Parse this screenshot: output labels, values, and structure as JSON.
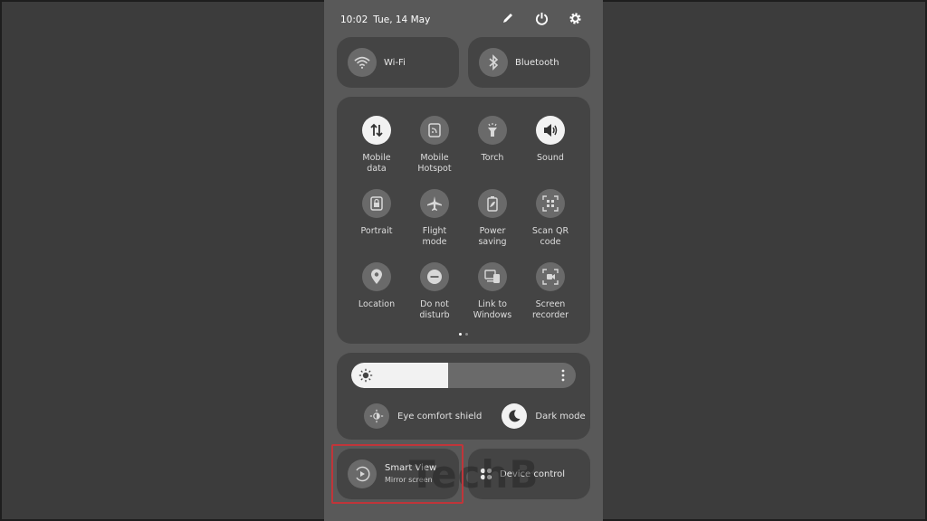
{
  "status": {
    "time": "10:02",
    "date": "Tue, 14 May"
  },
  "header_icons": [
    "edit-icon",
    "power-icon",
    "settings-icon"
  ],
  "top_tiles": [
    {
      "label": "Wi-Fi",
      "icon": "wifi-icon"
    },
    {
      "label": "Bluetooth",
      "icon": "bluetooth-icon"
    }
  ],
  "quick_settings": [
    {
      "label": "Mobile\ndata",
      "icon": "mobile-data-icon",
      "active": true
    },
    {
      "label": "Mobile\nHotspot",
      "icon": "hotspot-icon",
      "active": false
    },
    {
      "label": "Torch",
      "icon": "torch-icon",
      "active": false
    },
    {
      "label": "Sound",
      "icon": "sound-icon",
      "active": true
    },
    {
      "label": "Portrait",
      "icon": "portrait-lock-icon",
      "active": false
    },
    {
      "label": "Flight\nmode",
      "icon": "airplane-icon",
      "active": false
    },
    {
      "label": "Power\nsaving",
      "icon": "battery-saving-icon",
      "active": false
    },
    {
      "label": "Scan QR\ncode",
      "icon": "qr-scan-icon",
      "active": false
    },
    {
      "label": "Location",
      "icon": "location-icon",
      "active": false
    },
    {
      "label": "Do not\ndisturb",
      "icon": "do-not-disturb-icon",
      "active": false
    },
    {
      "label": "Link to\nWindows",
      "icon": "link-to-windows-icon",
      "active": false
    },
    {
      "label": "Screen\nrecorder",
      "icon": "screen-recorder-icon",
      "active": false
    }
  ],
  "brightness": {
    "level_percent": 43
  },
  "display_toggles": [
    {
      "label": "Eye comfort shield",
      "icon": "eye-comfort-icon",
      "active": false
    },
    {
      "label": "Dark mode",
      "icon": "moon-icon",
      "active": true
    }
  ],
  "bottom_tiles": {
    "smart_view": {
      "label": "Smart View",
      "sub": "Mirror screen"
    },
    "device_control": {
      "label": "Device control"
    }
  },
  "watermark": "TechB",
  "colors": {
    "panel_bg": "#595959",
    "card_bg": "#444444",
    "active_tile": "#f2f2f2",
    "highlight_border": "#c0353a"
  }
}
